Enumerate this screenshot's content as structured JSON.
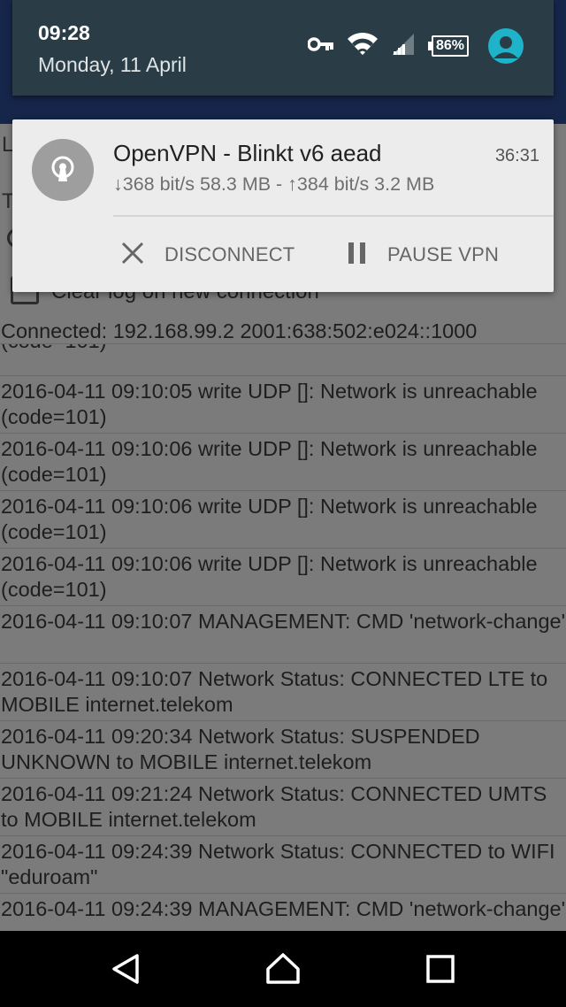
{
  "status_bar": {
    "time": "09:28",
    "date": "Monday, 11 April",
    "battery": "86%",
    "icons": [
      "vpn-key-icon",
      "wifi-icon",
      "cell-signal-icon",
      "battery-icon",
      "user-avatar-icon"
    ]
  },
  "background_app": {
    "partial_label_l": "L",
    "partial_label_t": "T",
    "clear_log_label": "Clear log on new connection",
    "connected_line": "Connected: 192.168.99.2 2001:638:502:e024::1000",
    "log_entries": [
      "(code=101)",
      "2016-04-11 09:10:05 write UDP []: Network is unreachable (code=101)",
      "2016-04-11 09:10:06 write UDP []: Network is unreachable (code=101)",
      "2016-04-11 09:10:06 write UDP []: Network is unreachable (code=101)",
      "2016-04-11 09:10:06 write UDP []: Network is unreachable (code=101)",
      "2016-04-11 09:10:07 MANAGEMENT: CMD 'network-change'",
      "2016-04-11 09:10:07 Network Status: CONNECTED LTE to MOBILE internet.telekom",
      "2016-04-11 09:20:34 Network Status: SUSPENDED UNKNOWN to MOBILE internet.telekom",
      "2016-04-11 09:21:24 Network Status: CONNECTED UMTS to MOBILE internet.telekom",
      "2016-04-11 09:24:39 Network Status: CONNECTED  to WIFI \"eduroam\"",
      "2016-04-11 09:24:39 MANAGEMENT: CMD 'network-change'"
    ]
  },
  "notification": {
    "title": "OpenVPN - Blinkt v6 aead",
    "elapsed": "36:31",
    "text": "↓368 bit/s 58.3 MB - ↑384 bit/s 3.2 MB",
    "icon": "openvpn-icon",
    "actions": {
      "disconnect_label": "DISCONNECT",
      "pause_label": "PAUSE VPN"
    }
  },
  "nav_bar": {
    "icons": [
      "back-icon",
      "home-icon",
      "recents-icon"
    ]
  }
}
